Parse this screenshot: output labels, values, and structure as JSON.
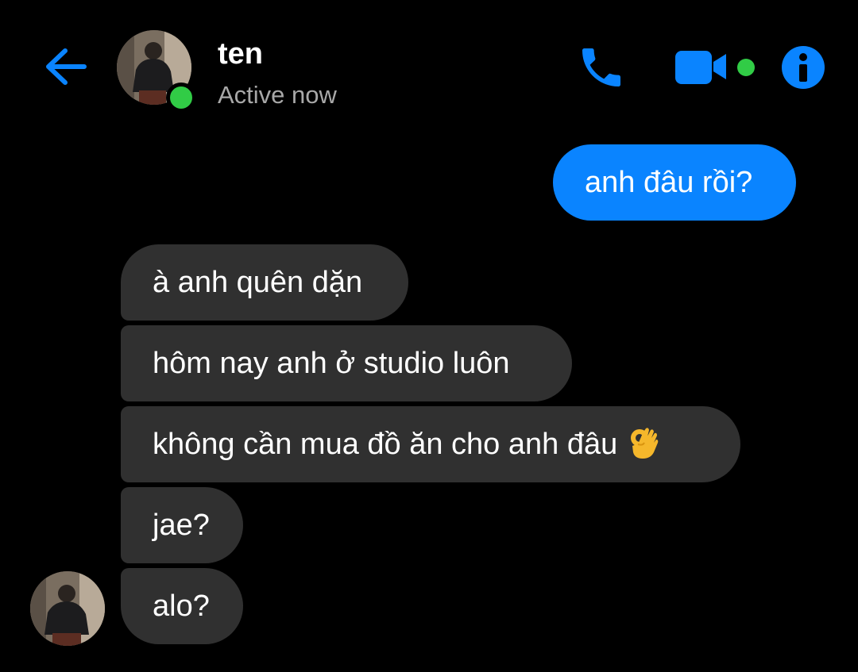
{
  "header": {
    "contact_name": "ten",
    "status": "Active now",
    "back_icon": "arrow-left-icon",
    "call_icon": "phone-icon",
    "video_icon": "video-camera-icon",
    "info_icon": "info-icon"
  },
  "colors": {
    "accent": "#0a84ff",
    "online": "#31cc46",
    "incoming_bubble": "#303030",
    "background": "#000000",
    "status_text": "#a8a8a8"
  },
  "messages": [
    {
      "direction": "outgoing",
      "text": "anh đâu rồi?"
    },
    {
      "direction": "incoming",
      "text": "à anh quên dặn"
    },
    {
      "direction": "incoming",
      "text": "hôm nay anh ở studio luôn"
    },
    {
      "direction": "incoming",
      "text": "không cần mua đồ ăn cho anh đâu",
      "emoji": "ok-hand-emoji"
    },
    {
      "direction": "incoming",
      "text": "jae?"
    },
    {
      "direction": "incoming",
      "text": "alo?"
    }
  ]
}
